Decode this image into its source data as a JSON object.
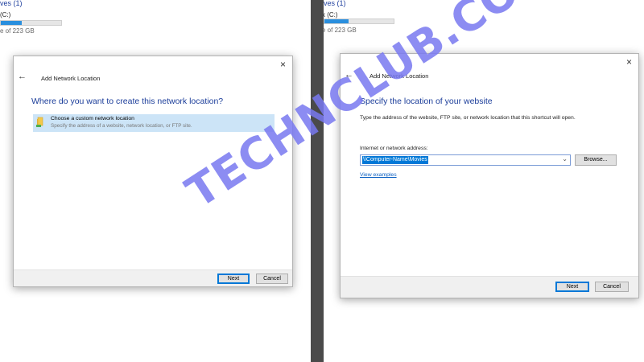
{
  "left": {
    "drive_header": "ives (1)",
    "drive_name": "(C:)",
    "drive_free": "e of 223 GB",
    "drive_fill_percent": 35,
    "dialog": {
      "close_icon": "×",
      "back_icon": "←",
      "title": "Add Network Location",
      "heading": "Where do you want to create this network location?",
      "option_title": "Choose a custom network location",
      "option_desc": "Specify the address of a website, network location, or FTP site.",
      "next_label": "Next",
      "cancel_label": "Cancel"
    }
  },
  "right": {
    "drive_header": "ives (1)",
    "drive_name": "k (C:)",
    "drive_free": "e of 223 GB",
    "drive_fill_percent": 35,
    "dialog": {
      "close_icon": "×",
      "back_icon": "←",
      "title": "Add Network Location",
      "heading": "Specify the location of your website",
      "description": "Type the address of the website, FTP site, or network location that this shortcut will open.",
      "address_label": "Internet or network address:",
      "address_value": "\\\\Computer-Name\\Movies",
      "dropdown_icon": "⌄",
      "browse_label": "Browse...",
      "view_examples": "View examples",
      "next_label": "Next",
      "cancel_label": "Cancel"
    }
  },
  "watermark": "TECHNCLUB.COM",
  "colors": {
    "accent": "#0078d7",
    "heading": "#1b3d9a",
    "selection": "#cce4f7",
    "divider": "#4a4a4a"
  }
}
